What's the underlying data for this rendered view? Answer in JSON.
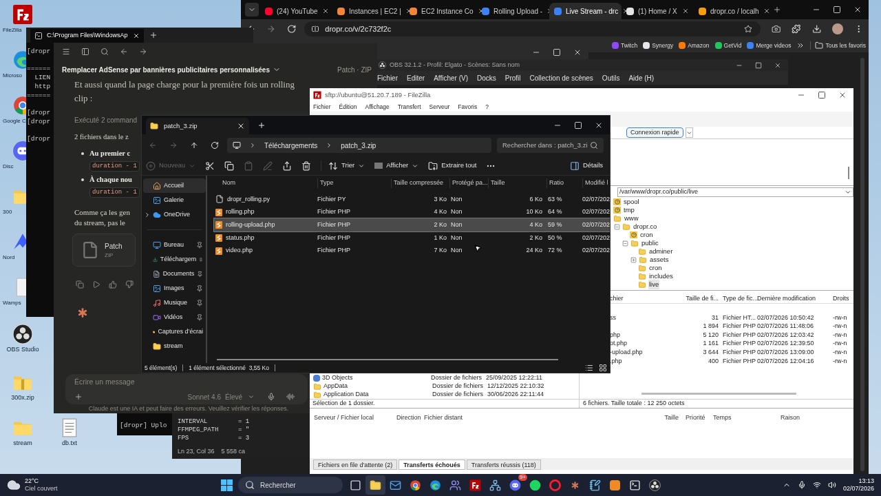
{
  "desktop_icons": [
    {
      "label": "FileZilla",
      "kind": "filezilla"
    },
    {
      "label": "Microso",
      "kind": "edge"
    },
    {
      "label": "Google C",
      "kind": "chrome"
    },
    {
      "label": "Disc",
      "kind": "discord"
    },
    {
      "label": "300",
      "kind": "folder"
    },
    {
      "label": "Nord",
      "kind": "nord"
    },
    {
      "label": "Wamps",
      "kind": "file"
    },
    {
      "label": "OBS Studio",
      "kind": "obs"
    },
    {
      "label": "300x.zip",
      "kind": "zip"
    },
    {
      "label": "stream",
      "kind": "folder"
    },
    {
      "label": "db.txt",
      "kind": "text"
    }
  ],
  "browser": {
    "tabs": [
      {
        "title": "(24) YouTube",
        "color": "#ff0033",
        "selected": false
      },
      {
        "title": "Instances | EC2 |",
        "color": "#f58536",
        "selected": false
      },
      {
        "title": "EC2 Instance Co",
        "color": "#f58536",
        "selected": false
      },
      {
        "title": "Rolling Upload -",
        "color": "#3b82f6",
        "selected": false
      },
      {
        "title": "Live Stream - drc",
        "color": "#3b82f6",
        "selected": true
      },
      {
        "title": "(1) Home / X",
        "color": "#e5e5e5",
        "selected": false
      },
      {
        "title": "dropr.co / localh",
        "color": "#f59e0b",
        "selected": false
      }
    ],
    "address": "dropr.co/v/2c732f2c",
    "bookmarks": [
      {
        "label": "Twitch",
        "color": "#9146ff"
      },
      {
        "label": "Synergy",
        "color": "#e5e7eb"
      },
      {
        "label": "Amazon",
        "color": "#ff7a00"
      },
      {
        "label": "GetVid",
        "color": "#22c55e"
      },
      {
        "label": "Merge videos",
        "color": "#3b82f6"
      }
    ],
    "all_bookmarks": "Tous les favoris"
  },
  "obs": {
    "title": "OBS 32.1.2 - Profil: Elgato - Scènes: Sans nom",
    "menu": [
      "Fichier",
      "Editer",
      "Afficher (V)",
      "Docks",
      "Profil",
      "Collection de scènes",
      "Outils",
      "Aide (H)"
    ]
  },
  "terminal": {
    "tab_title": "C:\\Program Files\\WindowsAp",
    "blocks": [
      [
        "[dropr"
      ],
      [
        "======",
        "  LIEN",
        "  http",
        "======"
      ],
      [
        "[dropr",
        "[dropr"
      ],
      [
        "[dropr"
      ]
    ]
  },
  "claude": {
    "title": "Remplacer AdSense par bannières publicitaires personnalisées",
    "artifact_label": "Patch · ZIP",
    "message": "Et aussi quand la page charge pour la première fois un rolling clip :",
    "tool_summary": "Exécuté 2 command",
    "intro": "2 fichiers dans le z",
    "bullets": [
      {
        "text": "Au premier c",
        "code": "duration - 1"
      },
      {
        "text": "À chaque nou",
        "code": "duration - 1"
      }
    ],
    "closing_lines": [
      "Comme ça les gen",
      "du stream, pas le"
    ],
    "attachment": {
      "name": "Patch",
      "type": "ZIP"
    },
    "input_placeholder": "Écrire un message",
    "model": "Sonnet 4.6",
    "effort": "Élevé",
    "disclaimer": "Claude est une IA et peut faire des erreurs. Veuillez vérifier les réponses."
  },
  "back_terminal": {
    "line": "[dropr] Uplo"
  },
  "editor": {
    "lines": [
      {
        "key": "INTERVAL",
        "value": "= 1"
      },
      {
        "key": "FFMPEG_PATH",
        "value": "= \""
      },
      {
        "key": "FPS",
        "value": "= 3"
      }
    ],
    "position": "Ln 23, Col 36",
    "chars": "5 558 ca"
  },
  "filezilla": {
    "title": "sftp://ubuntu@51.20.7.189 - FileZilla",
    "menu": [
      "Fichier",
      "Édition",
      "Affichage",
      "Transfert",
      "Serveur",
      "Favoris",
      "?"
    ],
    "quickconnect": "Connexion rapide",
    "remote_path": "/var/www/dropr.co/public/live",
    "tree": [
      {
        "name": "spool",
        "kind": "unknown",
        "selected": false
      },
      {
        "name": "tmp",
        "kind": "unknown",
        "selected": false
      },
      {
        "name": "www",
        "kind": "folder",
        "selected": false,
        "children": [
          {
            "name": "dropr.co",
            "kind": "folder",
            "selected": false,
            "expanded": true,
            "children": [
              {
                "name": "cron",
                "kind": "unknown",
                "selected": false
              },
              {
                "name": "public",
                "kind": "folder",
                "selected": false,
                "expanded": true,
                "children": [
                  {
                    "name": "adminer",
                    "kind": "folder",
                    "selected": false
                  },
                  {
                    "name": "assets",
                    "kind": "folder",
                    "selected": false,
                    "expanded": false
                  },
                  {
                    "name": "cron",
                    "kind": "folder",
                    "selected": false
                  },
                  {
                    "name": "includes",
                    "kind": "folder",
                    "selected": false
                  },
                  {
                    "name": "live",
                    "kind": "folder",
                    "selected": true
                  }
                ]
              }
            ]
          }
        ]
      }
    ],
    "remote_columns": [
      "chier",
      "Taille de fi...",
      "Type de fic...",
      "Dernière modification",
      "Droits"
    ],
    "remote_files": [
      {
        "name": "ss",
        "size": "31",
        "type": "Fichier HT...",
        "modified": "02/07/2026 10:50:42",
        "rights": "-rw-n"
      },
      {
        "size": "1 894",
        "type": "Fichier PHP",
        "modified": "02/07/2026 11:48:06",
        "rights": "-rw-n"
      },
      {
        "name": "php",
        "size": "5 120",
        "type": "Fichier PHP",
        "modified": "02/07/2026 12:03:42",
        "rights": "-rw-n"
      },
      {
        "name": "ot.php",
        "size": "1 161",
        "type": "Fichier PHP",
        "modified": "02/07/2026 12:39:50",
        "rights": "-rw-n"
      },
      {
        "name": "-upload.php",
        "size": "3 644",
        "type": "Fichier PHP",
        "modified": "02/07/2026 13:09:00",
        "rights": "-rw-n"
      },
      {
        "name": ".php",
        "size": "400",
        "type": "Fichier PHP",
        "modified": "02/07/2026 12:04:16",
        "rights": "-rw-n"
      }
    ],
    "local_files": [
      {
        "name": "3D Objects",
        "kind": "special",
        "type": "Dossier de fichiers",
        "modified": "25/09/2025 12:22:11"
      },
      {
        "name": "AppData",
        "kind": "folder",
        "type": "Dossier de fichiers",
        "modified": "12/12/2025 22:10:32"
      },
      {
        "name": "Application Data",
        "kind": "link",
        "type": "Dossier de fichiers",
        "modified": "30/06/2026 22:11:44"
      }
    ],
    "local_status": "Sélection de 1 dossier.",
    "remote_status": "6 fichiers. Taille totale : 12 250 octets",
    "queue_columns": [
      "Serveur / Fichier local",
      "Direction",
      "Fichier distant",
      "Taille",
      "Priorité",
      "Temps",
      "Raison"
    ],
    "queue_tabs": [
      {
        "label": "Fichiers en file d'attente (2)",
        "selected": false
      },
      {
        "label": "Transferts échoués",
        "selected": true
      },
      {
        "label": "Transferts réussis (118)",
        "selected": false
      }
    ]
  },
  "explorer": {
    "tab_title": "patch_3.zip",
    "breadcrumb": [
      "Téléchargements",
      "patch_3.zip"
    ],
    "search_placeholder": "Rechercher dans : patch_3.zi",
    "toolbar": [
      {
        "kind": "new",
        "label": "Nouveau",
        "disabled": true
      },
      {
        "kind": "cut",
        "disabled": false
      },
      {
        "kind": "copy",
        "disabled": false
      },
      {
        "kind": "paste",
        "disabled": true
      },
      {
        "kind": "rename",
        "disabled": true
      },
      {
        "kind": "share",
        "disabled": false
      },
      {
        "kind": "delete",
        "disabled": false
      },
      {
        "kind": "sort",
        "label": "Trier",
        "disabled": false
      },
      {
        "kind": "view",
        "label": "Afficher",
        "disabled": false
      },
      {
        "kind": "extract",
        "label": "Extraire tout",
        "disabled": false
      },
      {
        "kind": "more",
        "disabled": false
      }
    ],
    "details": "Détails",
    "sidebar": [
      {
        "label": "Accueil",
        "kind": "home",
        "selected": true,
        "pinned": false
      },
      {
        "label": "Galerie",
        "kind": "gallery",
        "selected": false,
        "pinned": false
      },
      {
        "label": "OneDrive",
        "kind": "cloud",
        "selected": false,
        "pinned": false,
        "expanded": false
      },
      {
        "label": "Bureau",
        "kind": "desktop",
        "selected": false,
        "pinned": true
      },
      {
        "label": "Téléchargem",
        "kind": "download",
        "selected": false,
        "pinned": true
      },
      {
        "label": "Documents",
        "kind": "documents",
        "selected": false,
        "pinned": true
      },
      {
        "label": "Images",
        "kind": "images",
        "selected": false,
        "pinned": true
      },
      {
        "label": "Musique",
        "kind": "music",
        "selected": false,
        "pinned": true
      },
      {
        "label": "Vidéos",
        "kind": "videos",
        "selected": false,
        "pinned": true
      },
      {
        "label": "Captures d’écrai",
        "kind": "folder",
        "selected": false,
        "pinned": false
      },
      {
        "label": "stream",
        "kind": "folder",
        "selected": false,
        "pinned": false
      }
    ],
    "columns": [
      "Nom",
      "Type",
      "Taille compressée",
      "Protégé pa...",
      "Taille",
      "Ratio",
      "Modifié l"
    ],
    "files": [
      {
        "name": "dropr_rolling.py",
        "kind": "py",
        "type": "Fichier PY",
        "compressed": "3 Ko",
        "protected": "Non",
        "size": "6 Ko",
        "ratio": "63 %",
        "modified": "02/07/202",
        "selected": false
      },
      {
        "name": "rolling.php",
        "kind": "php",
        "type": "Fichier PHP",
        "compressed": "4 Ko",
        "protected": "Non",
        "size": "10 Ko",
        "ratio": "64 %",
        "modified": "02/07/202",
        "selected": false
      },
      {
        "name": "rolling-upload.php",
        "kind": "php",
        "type": "Fichier PHP",
        "compressed": "2 Ko",
        "protected": "Non",
        "size": "4 Ko",
        "ratio": "59 %",
        "modified": "02/07/202",
        "selected": true
      },
      {
        "name": "status.php",
        "kind": "php",
        "type": "Fichier PHP",
        "compressed": "1 Ko",
        "protected": "Non",
        "size": "2 Ko",
        "ratio": "50 %",
        "modified": "02/07/202",
        "selected": false
      },
      {
        "name": "video.php",
        "kind": "php",
        "type": "Fichier PHP",
        "compressed": "7 Ko",
        "protected": "Non",
        "size": "24 Ko",
        "ratio": "72 %",
        "modified": "02/07/202",
        "selected": false
      }
    ],
    "status_count": "5 élément(s)",
    "status_selection": "1 élément sélectionné  3,55 Ko"
  },
  "taskbar": {
    "temperature": "22°C",
    "weather": "Ciel couvert",
    "search": "Rechercher",
    "apps": [
      {
        "kind": "taskview",
        "active": false
      },
      {
        "kind": "explorer",
        "active": true
      },
      {
        "kind": "mail",
        "active": false
      },
      {
        "kind": "chrome",
        "active": false
      },
      {
        "kind": "edge",
        "active": false
      },
      {
        "kind": "teams",
        "active": false
      },
      {
        "kind": "filezilla",
        "active": false
      },
      {
        "kind": "network",
        "active": false
      },
      {
        "kind": "discord",
        "active": false,
        "badge": "9+"
      },
      {
        "kind": "spotify",
        "active": false
      },
      {
        "kind": "opera",
        "active": false
      },
      {
        "kind": "claude",
        "active": false
      },
      {
        "kind": "notepad",
        "active": false
      },
      {
        "kind": "sublime",
        "active": false
      },
      {
        "kind": "terminal",
        "active": false
      },
      {
        "kind": "obs",
        "active": false
      }
    ],
    "time": "13:13",
    "date": "02/07/2026"
  }
}
